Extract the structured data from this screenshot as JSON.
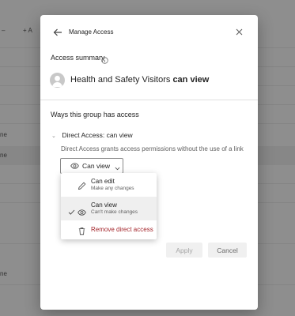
{
  "background": {
    "header_fragment_a": "–",
    "header_fragment_b": "+ A",
    "row_fragments": [
      "ne",
      "ne",
      "ne"
    ]
  },
  "dialog": {
    "title": "Manage Access",
    "access_summary_label": "Access summary",
    "group_name": "Health and Safety Visitors",
    "group_permission": "can view",
    "ways_heading": "Ways this group has access",
    "direct_access_heading": "Direct Access: can view",
    "direct_access_description": "Direct Access grants access permissions without the use of a link",
    "permission_button_label": "Can view",
    "menu": {
      "edit_label": "Can edit",
      "edit_sublabel": "Make any changes",
      "view_label": "Can view",
      "view_sublabel": "Can't make changes",
      "remove_label": "Remove direct access",
      "selected": "Can view"
    },
    "apply_label": "Apply",
    "cancel_label": "Cancel"
  },
  "colors": {
    "remove_text": "#a4262c",
    "overlay": "#000000"
  }
}
